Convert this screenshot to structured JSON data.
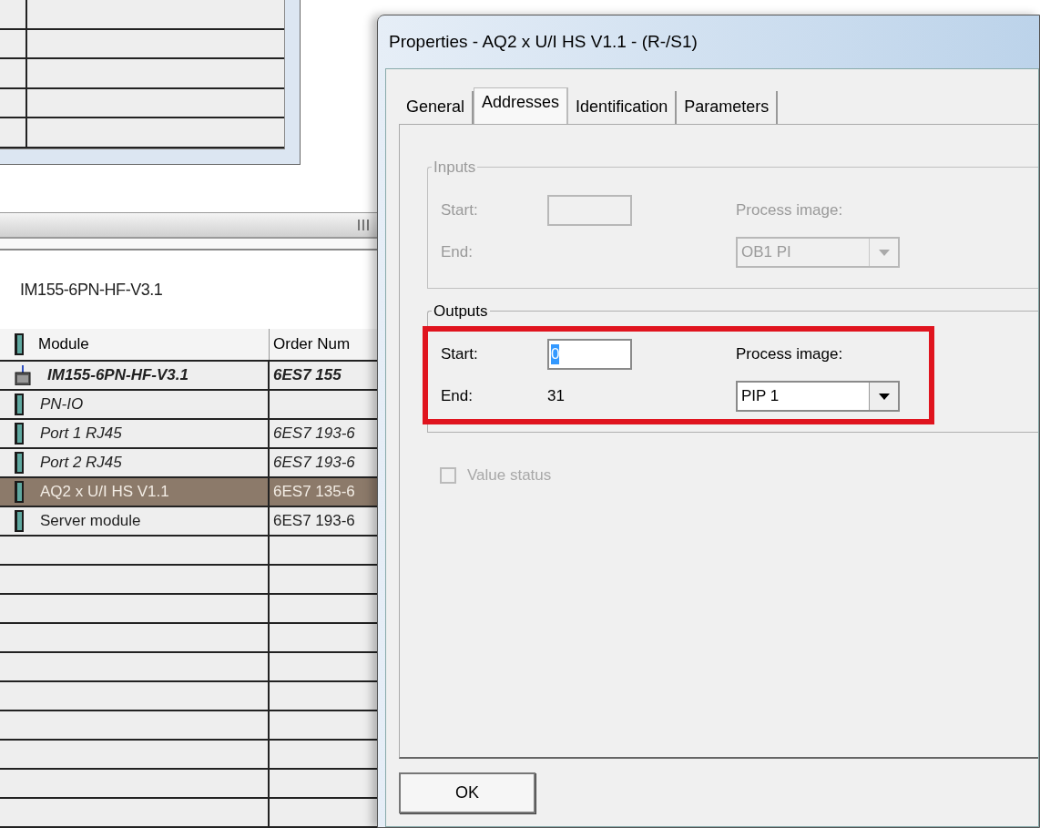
{
  "station": {
    "title": "IM155-6PN-HF-V3.1",
    "columns": [
      "Module",
      "Order Num"
    ],
    "rows": [
      {
        "kind": "station",
        "module": "IM155-6PN-HF-V3.1",
        "order": "6ES7 155",
        "selected": false
      },
      {
        "kind": "interface",
        "module": "PN-IO",
        "selected": false
      },
      {
        "kind": "interface",
        "module": "Port 1 RJ45",
        "order": "6ES7 193-6",
        "selected": false
      },
      {
        "kind": "interface",
        "module": "Port 2 RJ45",
        "order": "6ES7 193-6",
        "selected": false
      },
      {
        "kind": "module",
        "module": "AQ2 x U/I HS V1.1",
        "order": "6ES7 135-6",
        "selected": true
      },
      {
        "kind": "module",
        "module": "Server module",
        "order": "6ES7 193-6",
        "selected": false
      }
    ]
  },
  "dialog": {
    "title": "Properties - AQ2 x U/I HS V1.1 - (R-/S1)",
    "tabs": [
      {
        "label": "General",
        "selected": false
      },
      {
        "label": "Addresses",
        "selected": true
      },
      {
        "label": "Identification",
        "selected": false
      },
      {
        "label": "Parameters",
        "selected": false
      }
    ],
    "groups": [
      {
        "legend": "Inputs",
        "disabled": true,
        "highlighted": false,
        "start_label": "Start:",
        "end_label": "End:",
        "process_image_label": "Process image:",
        "process_image_value": "OB1 PI"
      },
      {
        "legend": "Outputs",
        "disabled": false,
        "highlighted": true,
        "start_label": "Start:",
        "start_value": "0",
        "end_label": "End:",
        "end_value": "31",
        "process_image_label": "Process image:",
        "process_image_value": "PIP 1"
      }
    ],
    "value_status": {
      "label": "Value status",
      "checked": false,
      "disabled": true
    },
    "ok_button": "OK"
  }
}
